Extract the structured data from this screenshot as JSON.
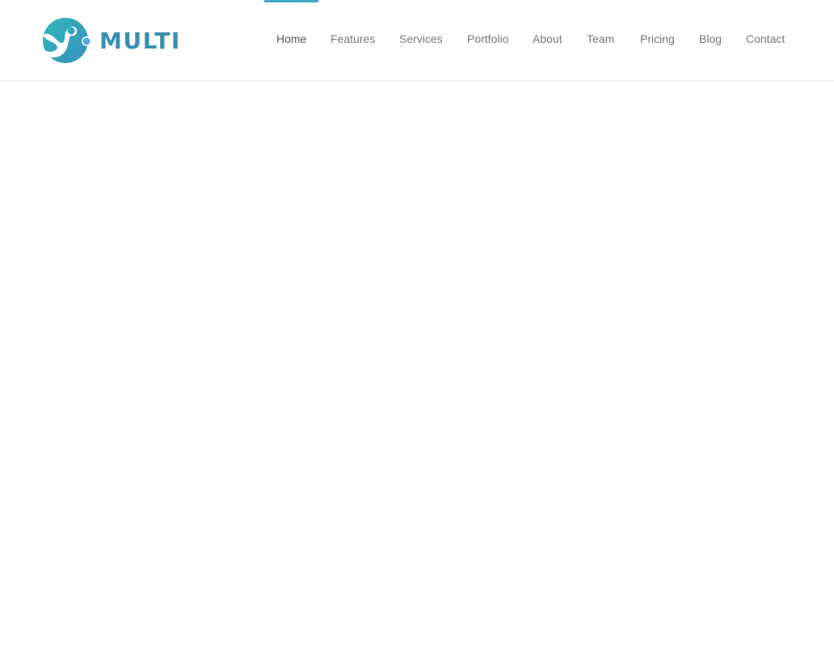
{
  "brand": {
    "name": "MULTI",
    "icon": "logo-swirl-icon",
    "color": "#3a8fb0"
  },
  "nav": {
    "active_index": 0,
    "accent_color": "#3fa9c9",
    "items": [
      {
        "label": "Home"
      },
      {
        "label": "Features"
      },
      {
        "label": "Services"
      },
      {
        "label": "Portfolio"
      },
      {
        "label": "About"
      },
      {
        "label": "Team"
      },
      {
        "label": "Pricing"
      },
      {
        "label": "Blog"
      },
      {
        "label": "Contact"
      }
    ]
  }
}
